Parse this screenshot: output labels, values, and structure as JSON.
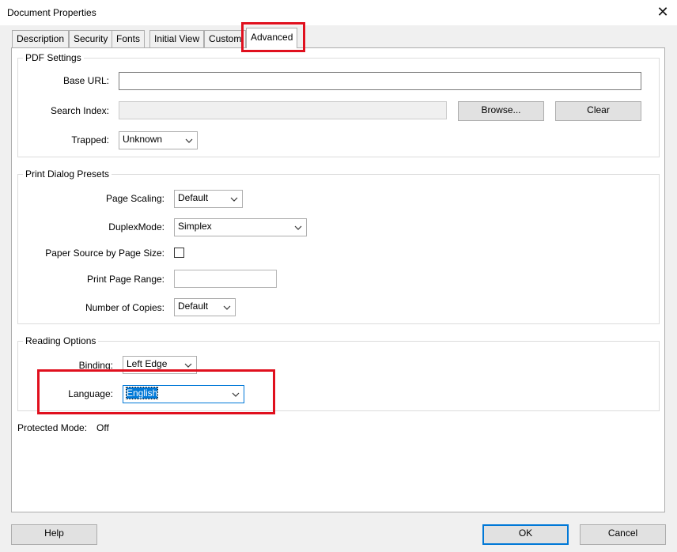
{
  "window": {
    "title": "Document Properties"
  },
  "tabs": [
    {
      "label": "Description"
    },
    {
      "label": "Security"
    },
    {
      "label": "Fonts"
    },
    {
      "label": "Initial View"
    },
    {
      "label": "Custom"
    },
    {
      "label": "Advanced"
    }
  ],
  "pdf_settings": {
    "title": "PDF Settings",
    "base_url_label": "Base URL:",
    "base_url_value": "",
    "search_index_label": "Search Index:",
    "search_index_value": "",
    "browse_label": "Browse...",
    "clear_label": "Clear",
    "trapped_label": "Trapped:",
    "trapped_value": "Unknown"
  },
  "print_presets": {
    "title": "Print Dialog Presets",
    "page_scaling_label": "Page Scaling:",
    "page_scaling_value": "Default",
    "duplex_label": "DuplexMode:",
    "duplex_value": "Simplex",
    "paper_source_label": "Paper Source by Page Size:",
    "paper_source_checked": false,
    "print_range_label": "Print Page Range:",
    "print_range_value": "",
    "copies_label": "Number of Copies:",
    "copies_value": "Default"
  },
  "reading_options": {
    "title": "Reading Options",
    "binding_label": "Binding:",
    "binding_value": "Left Edge",
    "language_label": "Language:",
    "language_value": "English"
  },
  "protected_mode": {
    "label": "Protected Mode:",
    "value": "Off"
  },
  "footer": {
    "help_label": "Help",
    "ok_label": "OK",
    "cancel_label": "Cancel"
  },
  "colors": {
    "highlight": "#e0101e",
    "accent": "#0078d7"
  }
}
